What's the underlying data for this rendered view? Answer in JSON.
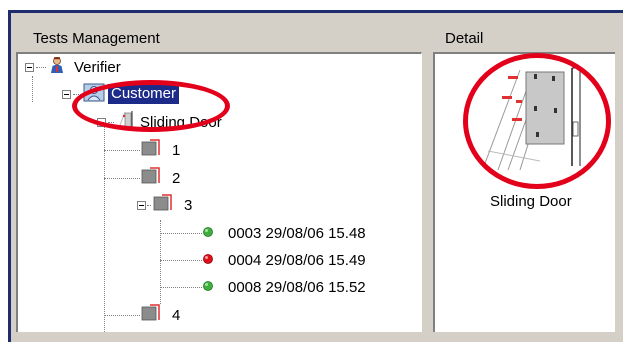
{
  "panels": {
    "tests_management_label": "Tests Management",
    "detail_label": "Detail"
  },
  "tree": {
    "root": {
      "label": "Verifier",
      "icon": "user-verifier-icon"
    },
    "customer": {
      "label": "Customer",
      "icon": "customer-icon",
      "selected": true
    },
    "product": {
      "label": "Sliding Door",
      "icon": "sliding-door-icon"
    },
    "items": [
      {
        "label": "1"
      },
      {
        "label": "2"
      },
      {
        "label": "3"
      },
      {
        "label": "4"
      }
    ],
    "tests": [
      {
        "label": "0003 29/08/06 15.48",
        "status": "green",
        "color": "#3fae3f"
      },
      {
        "label": "0004 29/08/06 15.49",
        "status": "red",
        "color": "#e0101a"
      },
      {
        "label": "0008 29/08/06 15.52",
        "status": "green",
        "color": "#3fae3f"
      }
    ]
  },
  "detail": {
    "caption": "Sliding Door"
  },
  "colors": {
    "selection": "#1c2a8a",
    "annotation_ring": "#e3001b",
    "frame": "#1f2c6e"
  }
}
